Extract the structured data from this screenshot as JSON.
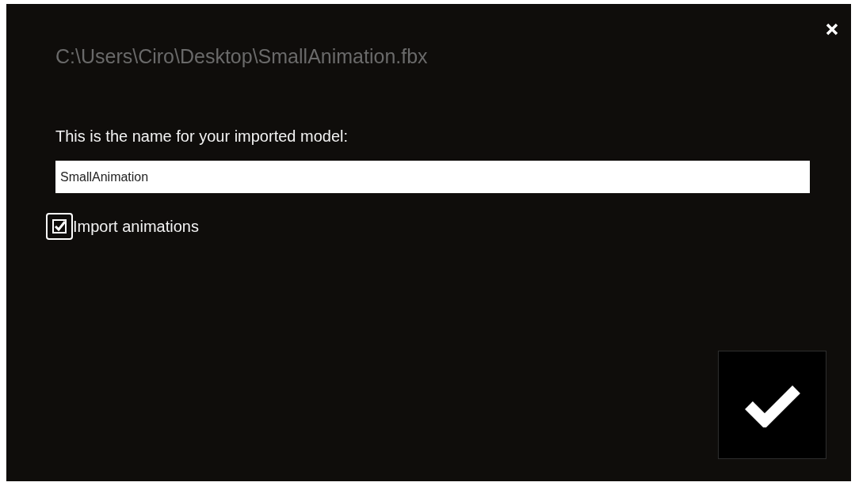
{
  "dialog": {
    "title": "C:\\Users\\Ciro\\Desktop\\SmallAnimation.fbx",
    "prompt": "This is the name for your imported model:",
    "name_field": {
      "value": "SmallAnimation"
    },
    "import_animations": {
      "label": "Import animations",
      "checked": true
    }
  }
}
